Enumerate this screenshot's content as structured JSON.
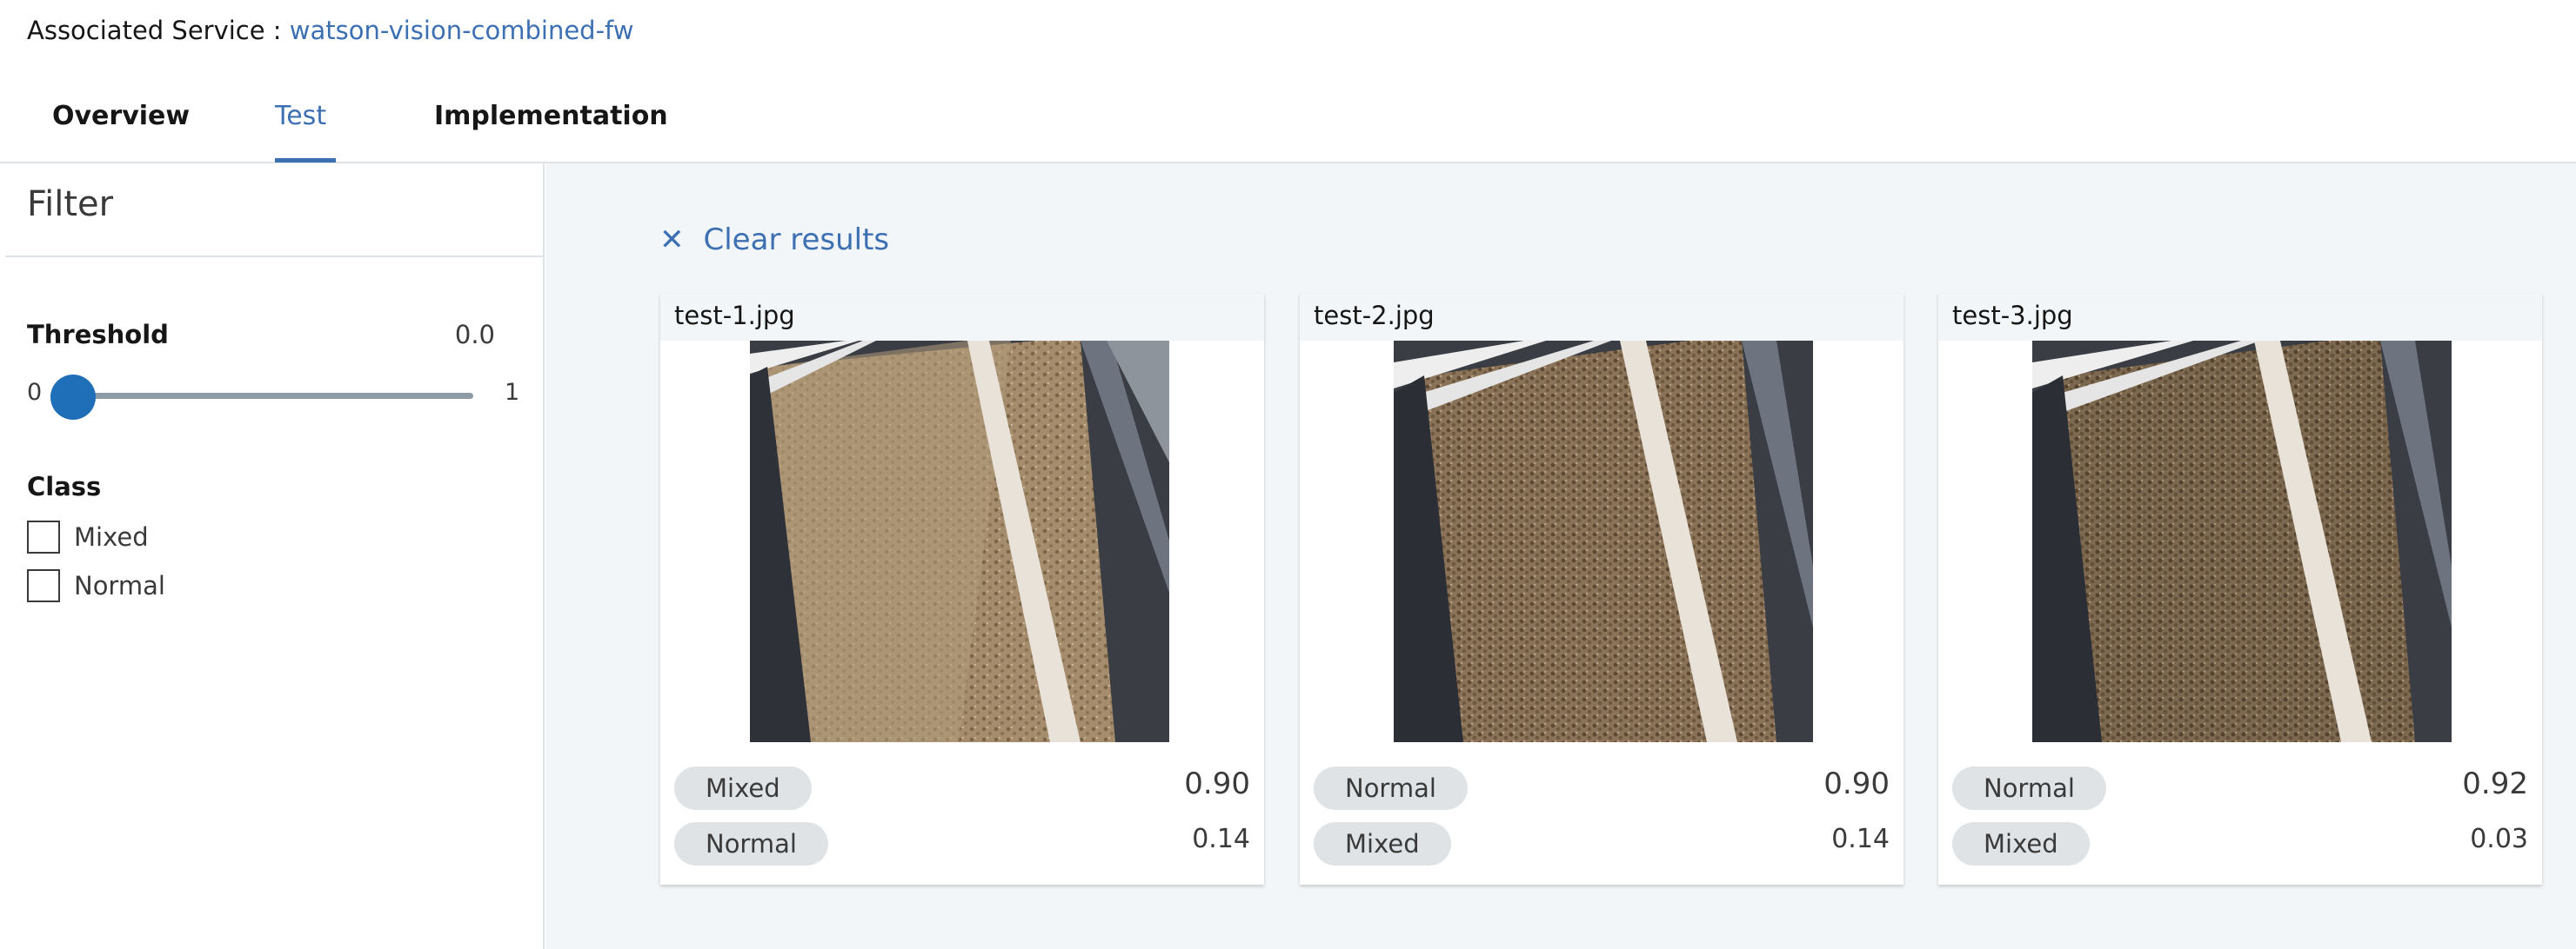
{
  "header": {
    "service_label": "Associated Service : ",
    "service_name": "watson-vision-combined-fw"
  },
  "tabs": [
    {
      "label": "Overview"
    },
    {
      "label": "Test"
    },
    {
      "label": "Implementation"
    }
  ],
  "active_tab": "Test",
  "filter": {
    "title": "Filter",
    "threshold_label": "Threshold",
    "threshold_value": "0.0",
    "slider_min": "0",
    "slider_max": "1",
    "class_label": "Class",
    "classes": [
      {
        "label": "Mixed",
        "checked": false
      },
      {
        "label": "Normal",
        "checked": false
      }
    ]
  },
  "results": {
    "clear_label": "Clear results",
    "clear_icon": "close-icon",
    "cards": [
      {
        "filename": "test-1.jpg",
        "results": [
          {
            "class": "Mixed",
            "score": "0.90"
          },
          {
            "class": "Normal",
            "score": "0.14"
          }
        ]
      },
      {
        "filename": "test-2.jpg",
        "results": [
          {
            "class": "Normal",
            "score": "0.90"
          },
          {
            "class": "Mixed",
            "score": "0.14"
          }
        ]
      },
      {
        "filename": "test-3.jpg",
        "results": [
          {
            "class": "Normal",
            "score": "0.92"
          },
          {
            "class": "Mixed",
            "score": "0.03"
          }
        ]
      }
    ]
  },
  "colors": {
    "accent": "#3d70b2",
    "slider_thumb": "#1f6fb8",
    "panel_bg": "#f3f6f8",
    "tag_bg": "#dfe3e6"
  }
}
